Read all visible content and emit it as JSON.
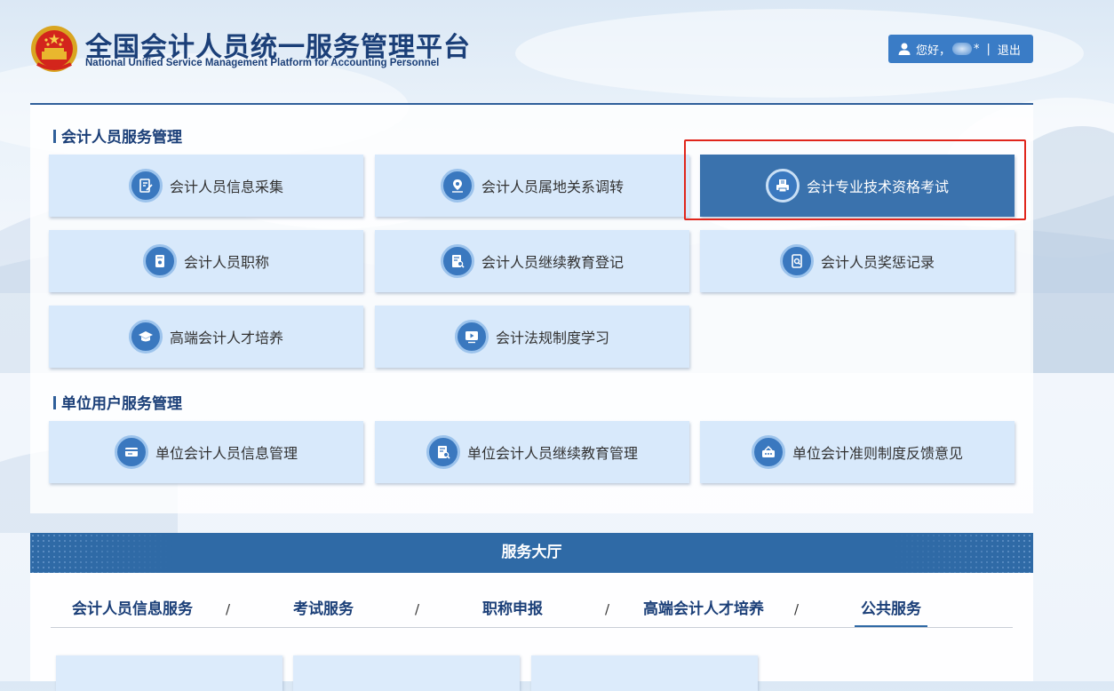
{
  "header": {
    "title_cn": "全国会计人员统一服务管理平台",
    "title_en": "National Unified Service Management Platform for Accounting Personnel",
    "greeting": "您好，",
    "username_masked": "*",
    "divider": "|",
    "logout_label": "退出"
  },
  "sections": [
    {
      "title": "会计人员服务管理",
      "items": [
        {
          "label": "会计人员信息采集",
          "icon": "edit-form-icon"
        },
        {
          "label": "会计人员属地关系调转",
          "icon": "location-pin-icon"
        },
        {
          "label": "会计专业技术资格考试",
          "icon": "exam-printer-icon",
          "active": true
        },
        {
          "label": "会计人员职称",
          "icon": "document-badge-icon"
        },
        {
          "label": "会计人员继续教育登记",
          "icon": "document-search-icon"
        },
        {
          "label": "会计人员奖惩记录",
          "icon": "record-search-icon"
        },
        {
          "label": "高端会计人才培养",
          "icon": "graduation-cap-icon"
        },
        {
          "label": "会计法规制度学习",
          "icon": "video-play-icon"
        }
      ]
    },
    {
      "title": "单位用户服务管理",
      "items": [
        {
          "label": "单位会计人员信息管理",
          "icon": "id-card-icon"
        },
        {
          "label": "单位会计人员继续教育管理",
          "icon": "document-search-icon"
        },
        {
          "label": "单位会计准则制度反馈意见",
          "icon": "feedback-box-icon"
        }
      ]
    }
  ],
  "hall": {
    "title": "服务大厅",
    "tabs": [
      "会计人员信息服务",
      "考试服务",
      "职称申报",
      "高端会计人才培养",
      "公共服务"
    ],
    "active_tab": "公共服务",
    "separator": "/"
  },
  "colors": {
    "brand_dark": "#1b3f78",
    "accent": "#3a72ad",
    "tile_bg": "#d8e9fb",
    "highlight_red": "#e0261c"
  }
}
